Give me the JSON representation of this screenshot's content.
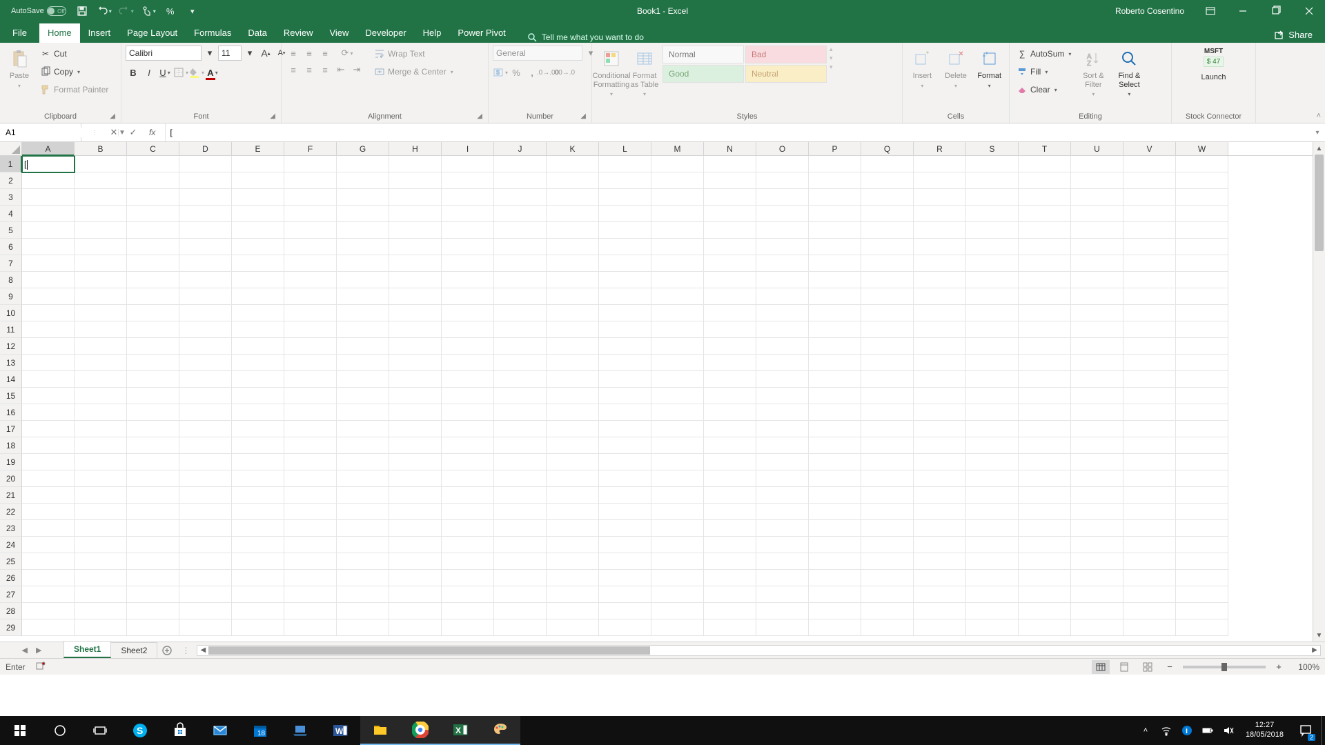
{
  "titlebar": {
    "autosave_label": "AutoSave",
    "autosave_state": "Off",
    "document_title": "Book1 - Excel",
    "user_name": "Roberto Cosentino"
  },
  "tabs": {
    "file": "File",
    "list": [
      "Home",
      "Insert",
      "Page Layout",
      "Formulas",
      "Data",
      "Review",
      "View",
      "Developer",
      "Help",
      "Power Pivot"
    ],
    "active": "Home",
    "tellme": "Tell me what you want to do",
    "share": "Share"
  },
  "ribbon": {
    "clipboard": {
      "paste": "Paste",
      "cut": "Cut",
      "copy": "Copy",
      "format_painter": "Format Painter",
      "label": "Clipboard"
    },
    "font": {
      "name": "Calibri",
      "size": "11",
      "label": "Font"
    },
    "alignment": {
      "wrap": "Wrap Text",
      "merge": "Merge & Center",
      "label": "Alignment"
    },
    "number": {
      "format": "General",
      "label": "Number"
    },
    "styles": {
      "conditional": "Conditional Formatting",
      "formatas": "Format as Table",
      "normal": "Normal",
      "bad": "Bad",
      "good": "Good",
      "neutral": "Neutral",
      "label": "Styles"
    },
    "cells": {
      "insert": "Insert",
      "delete": "Delete",
      "format": "Format",
      "label": "Cells"
    },
    "editing": {
      "autosum": "AutoSum",
      "fill": "Fill",
      "clear": "Clear",
      "sort": "Sort & Filter",
      "find": "Find & Select",
      "label": "Editing"
    },
    "stock": {
      "msft": "MSFT",
      "price": "$ 47",
      "launch": "Launch",
      "label": "Stock Connector"
    }
  },
  "formula": {
    "namebox": "A1",
    "value": "[",
    "fx": "fx"
  },
  "grid": {
    "columns": [
      "A",
      "B",
      "C",
      "D",
      "E",
      "F",
      "G",
      "H",
      "I",
      "J",
      "K",
      "L",
      "M",
      "N",
      "O",
      "P",
      "Q",
      "R",
      "S",
      "T",
      "U",
      "V",
      "W"
    ],
    "row_count": 29,
    "active_cell": "A1",
    "cell_A1": "["
  },
  "sheets": {
    "list": [
      "Sheet1",
      "Sheet2"
    ],
    "active": "Sheet1"
  },
  "status": {
    "mode": "Enter",
    "zoom": "100%"
  },
  "taskbar": {
    "time": "12:27",
    "date": "18/05/2018",
    "notification_count": "2"
  }
}
